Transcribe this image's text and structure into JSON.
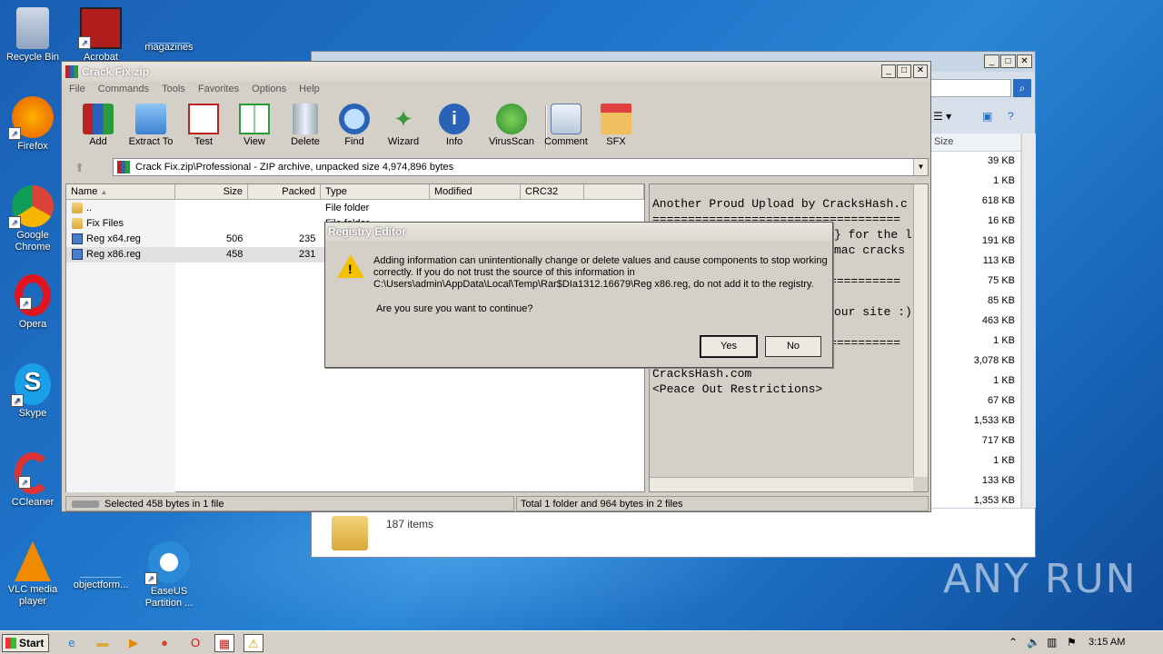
{
  "desktop_icons": [
    {
      "label": "Recycle Bin",
      "icon": "recycle-bin-icon"
    },
    {
      "label": "Acrobat",
      "icon": "acrobat-icon"
    },
    {
      "label": "magazines",
      "icon": "folder-icon"
    },
    {
      "label": "Firefox",
      "icon": "firefox-icon"
    },
    {
      "label": "Google Chrome",
      "icon": "chrome-icon"
    },
    {
      "label": "Opera",
      "icon": "opera-icon"
    },
    {
      "label": "Skype",
      "icon": "skype-icon"
    },
    {
      "label": "CCleaner",
      "icon": "ccleaner-icon"
    },
    {
      "label": "VLC media player",
      "icon": "vlc-icon"
    },
    {
      "label": "objectform...",
      "icon": "file-icon"
    },
    {
      "label": "EaseUS Partition ...",
      "icon": "easeus-icon"
    }
  ],
  "explorer": {
    "sizes": [
      "39 KB",
      "1 KB",
      "618 KB",
      "16 KB",
      "191 KB",
      "113 KB",
      "75 KB",
      "85 KB",
      "463 KB",
      "1 KB",
      "3,078 KB",
      "1 KB",
      "67 KB",
      "1,533 KB",
      "717 KB",
      "1 KB",
      "133 KB",
      "1,353 KB"
    ],
    "size_header": "Size",
    "item_count": "187 items"
  },
  "winrar": {
    "title": "Crack Fix.zip",
    "menu": [
      "File",
      "Commands",
      "Tools",
      "Favorites",
      "Options",
      "Help"
    ],
    "toolbar": [
      "Add",
      "Extract To",
      "Test",
      "View",
      "Delete",
      "Find",
      "Wizard",
      "Info",
      "VirusScan",
      "Comment",
      "SFX"
    ],
    "address": "Crack Fix.zip\\Professional - ZIP archive, unpacked size 4,974,896 bytes",
    "columns": [
      "Name",
      "Size",
      "Packed",
      "Type",
      "Modified",
      "CRC32"
    ],
    "rows": [
      {
        "name": "..",
        "size": "",
        "packed": "",
        "type": "File folder"
      },
      {
        "name": "Fix Files",
        "size": "",
        "packed": "",
        "type": "File folder"
      },
      {
        "name": "Reg x64.reg",
        "size": "506",
        "packed": "235",
        "type": ""
      },
      {
        "name": "Reg x86.reg",
        "size": "458",
        "packed": "231",
        "type": ""
      }
    ],
    "comment_lines": [
      "Another Proud Upload by CracksHash.c",
      "===================================",
      "} for the l",
      "mac cracks",
      "===================================",
      "our site :)",
      "===================================",
      "CracksHash.com",
      "<Peace Out Restrictions>"
    ],
    "status_left": "Selected 458 bytes in 1 file",
    "status_right": "Total 1 folder and 964 bytes in 2 files"
  },
  "dialog": {
    "title": "Registry Editor",
    "message": "Adding information can unintentionally change or delete values and cause components to stop working correctly. If you do not trust the source of this information in C:\\Users\\admin\\AppData\\Local\\Temp\\Rar$DIa1312.16679\\Reg x86.reg, do not add it to the registry.",
    "question": "Are you sure you want to continue?",
    "yes": "Yes",
    "no": "No"
  },
  "taskbar": {
    "start": "Start",
    "clock": "3:15 AM"
  },
  "watermark": "ANY RUN"
}
